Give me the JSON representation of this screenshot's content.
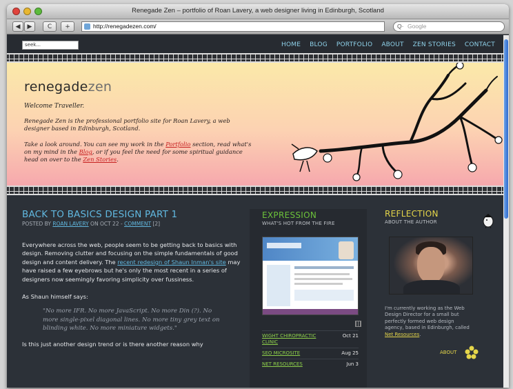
{
  "window": {
    "title": "Renegade Zen – portfolio of Roan Lavery, a web designer living in Edinburgh, Scotland"
  },
  "toolbar": {
    "url": "http://renegadezen.com/",
    "search_placeholder": "Google",
    "back_label": "◀",
    "forward_label": "▶",
    "reload_label": "C",
    "add_label": "+"
  },
  "site": {
    "search_value": "seek...",
    "nav": [
      "HOME",
      "BLOG",
      "PORTFOLIO",
      "ABOUT",
      "ZEN STORIES",
      "CONTACT"
    ],
    "logo_a": "renegade",
    "logo_b": "zen",
    "welcome": "Welcome Traveller.",
    "intro1": "Renegade Zen is the professional portfolio site for Roan Lavery, a web designer based in Edinburgh, Scotland.",
    "intro2_a": "Take a look around. You can see my work in the ",
    "intro2_link1": "Portfolio",
    "intro2_b": " section, read what's on my mind in the ",
    "intro2_link2": "Blog",
    "intro2_c": ", or if you feel the need for some spiritual guidance head on over to the ",
    "intro2_link3": "Zen Stories",
    "intro2_d": "."
  },
  "post": {
    "title": "BACK TO BASICS DESIGN PART 1",
    "meta_a": "POSTED BY ",
    "author": "ROAN LAVERY",
    "meta_b": " ON OCT 22 - ",
    "comment": "COMMENT",
    "comment_count": " [2]",
    "p1_a": "Everywhere across the web, people seem to be getting back to basics with design. Removing clutter and focusing on the simple fundamentals of good design and content delivery. The ",
    "p1_link": "recent redesign of Shaun Inman's site",
    "p1_b": " may have raised a few eyebrows but he's only the most recent in a series of designers now seemingly favoring simplicity over fussiness.",
    "p2": "As Shaun himself says:",
    "quote": "\"No more IFR. No more JavaScript. No more Din (?). No more single-pixel diagonal lines. No more tiny grey text on blinding white. No more miniature widgets.\"",
    "p3": "Is this just another design trend or is there another reason why"
  },
  "expression": {
    "title": "EXPRESSION",
    "subtitle": "WHAT'S HOT FROM THE FIRE",
    "items": [
      {
        "name": "WIGHT CHIROPRACTIC CLINIC",
        "date": "Oct 21"
      },
      {
        "name": "SEO MICROSITE",
        "date": "Aug 25"
      },
      {
        "name": "NET RESOURCES",
        "date": "Jun 3"
      }
    ]
  },
  "reflection": {
    "title": "REFLECTION",
    "subtitle": "ABOUT THE AUTHOR",
    "text_a": "I'm currently working as the Web Design Director for a small but perfectly formed web design agency, based in Edinburgh, called ",
    "text_link": "Net Resources",
    "text_b": ".",
    "about_link": "ABOUT"
  },
  "colors": {
    "nav": "#8fd2ea",
    "title_blue": "#61b8e0",
    "green": "#6cc23a",
    "yellow": "#e5d64a",
    "bg": "#2c3138"
  }
}
